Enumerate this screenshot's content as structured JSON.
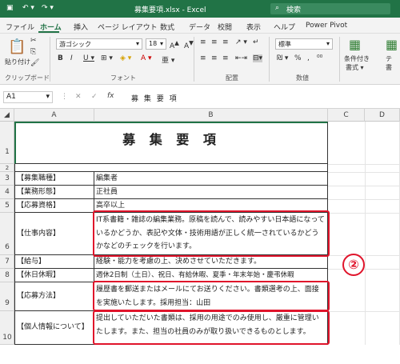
{
  "window": {
    "title": "募集要項.xlsx - Excel",
    "search": "検索"
  },
  "tabs": [
    "ファイル",
    "ホーム",
    "挿入",
    "ページ レイアウト",
    "数式",
    "データ",
    "校閲",
    "表示",
    "ヘルプ",
    "Power Pivot"
  ],
  "ribbon": {
    "paste": "貼り付け",
    "clipboard": "クリップボード",
    "font_name": "游ゴシック",
    "font_size": "18",
    "font_group": "フォント",
    "align_group": "配置",
    "number_format": "標準",
    "number_group": "数値",
    "conditional": "条件付き",
    "conditional2": "書式 ▾",
    "table_cut": "テ",
    "table_cut2": "書"
  },
  "formula": {
    "namebox": "A1",
    "fx": "fx",
    "content": "募 集 要 項"
  },
  "columns": [
    "A",
    "B",
    "C",
    "D"
  ],
  "rows": [
    "1",
    "2",
    "3",
    "4",
    "5",
    "6",
    "7",
    "8",
    "9",
    "10"
  ],
  "sheet": {
    "title": "募 集 要 項",
    "r3": {
      "a": "【募集職種】",
      "b": "編集者"
    },
    "r4": {
      "a": "【業務形態】",
      "b": "正社員"
    },
    "r5": {
      "a": "【応募資格】",
      "b": "高卒以上"
    },
    "r6": {
      "a": "【仕事内容】",
      "b": "IT系書籍・雑誌の編集業務。原稿を読んで、読みやすい日本語になっているかどうか、表記や文体・技術用語が正しく統一されているかどうかなどのチェックを行います。"
    },
    "r7": {
      "a": "【給与】",
      "b": "経験・能力を考慮の上、決めさせていただきます。"
    },
    "r8": {
      "a": "【休日休暇】",
      "b": "週休2日制（土日）、祝日、有給休暇、夏季・年末年始・慶弔休暇"
    },
    "r9": {
      "a": "【応募方法】",
      "b": "履歴書を郵送またはメールにてお送りください。書類選考の上、面接を実施いたします。採用担当：山田"
    },
    "r10": {
      "a": "【個人情報について】",
      "b": "提出していただいた書類は、採用の用途でのみ使用し、厳重に管理いたします。また、担当の社員のみが取り扱いできるものとします。"
    }
  },
  "annotation": "②",
  "colors": {
    "excel_green": "#217346",
    "highlight_red": "#e0142b"
  }
}
